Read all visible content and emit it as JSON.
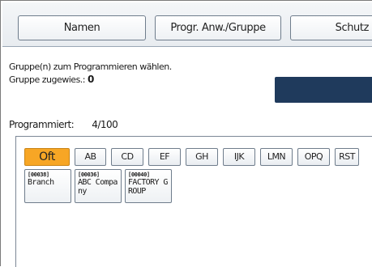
{
  "top_buttons": {
    "names": "Namen",
    "program": "Progr. Anw./Gruppe",
    "protection": "Schutz"
  },
  "instruction": "Gruppe(n) zum Programmieren wählen.",
  "assigned": {
    "label": "Gruppe zugewies.:",
    "count": "0"
  },
  "programmed": {
    "label": "Programmiert:",
    "value": "4/100"
  },
  "tabs": [
    "Oft",
    "AB",
    "CD",
    "EF",
    "GH",
    "IJK",
    "LMN",
    "OPQ",
    "RST"
  ],
  "active_tab": "Oft",
  "entries": [
    {
      "code": "[00038]",
      "name": "Branch"
    },
    {
      "code": "[00036]",
      "name": "ABC Company"
    },
    {
      "code": "[00040]",
      "name": "FACTORY GROUP"
    }
  ],
  "colors": {
    "active_tab": "#f7a625",
    "dark_box": "#1f3a5c"
  }
}
